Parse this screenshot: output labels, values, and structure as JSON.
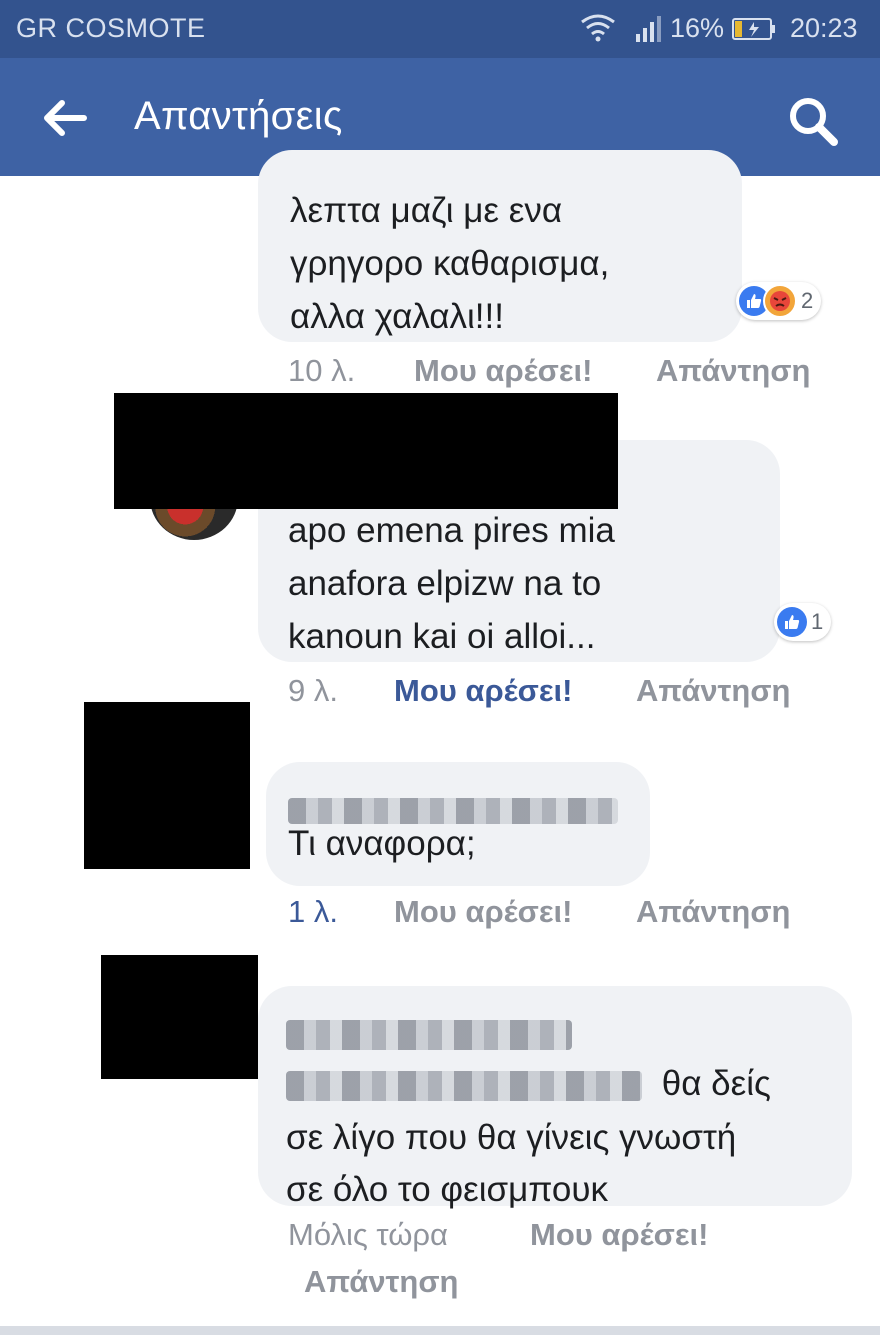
{
  "status_bar": {
    "carrier": "GR COSMOTE",
    "battery": "16%",
    "time": "20:23"
  },
  "header": {
    "title": "Απαντήσεις",
    "back_icon": "arrow-left-icon",
    "search_icon": "search-icon"
  },
  "comments": [
    {
      "text": "λεπτα μαζι με ενα\nγρηγορο καθαρισμα,\nαλλα χαλαλι!!!",
      "reaction_count": "2",
      "time": "10 λ.",
      "like": "Μου αρέσει!",
      "reply": "Απάντηση"
    },
    {
      "text": "apo emena pires mia\nanafora elpizw na to\nkanoun kai oi alloi...",
      "reaction_count": "1",
      "time": "9 λ.",
      "like": "Μου αρέσει!",
      "reply": "Απάντηση"
    },
    {
      "text": "Τι αναφορα;",
      "time": "1 λ.",
      "like": "Μου αρέσει!",
      "reply": "Απάντηση"
    },
    {
      "text_inline": "θα δείς",
      "text": "σε λίγο που θα γίνεις γνωστή\nσε όλο το φεισμπουκ",
      "time": "Μόλις τώρα",
      "like": "Μου αρέσει!",
      "reply": "Απάντηση"
    }
  ],
  "colors": {
    "status_bar": "#33538e",
    "header": "#3e62a4",
    "bubble": "#f0f2f5",
    "link_active": "#3b5998",
    "meta": "#90949c"
  }
}
